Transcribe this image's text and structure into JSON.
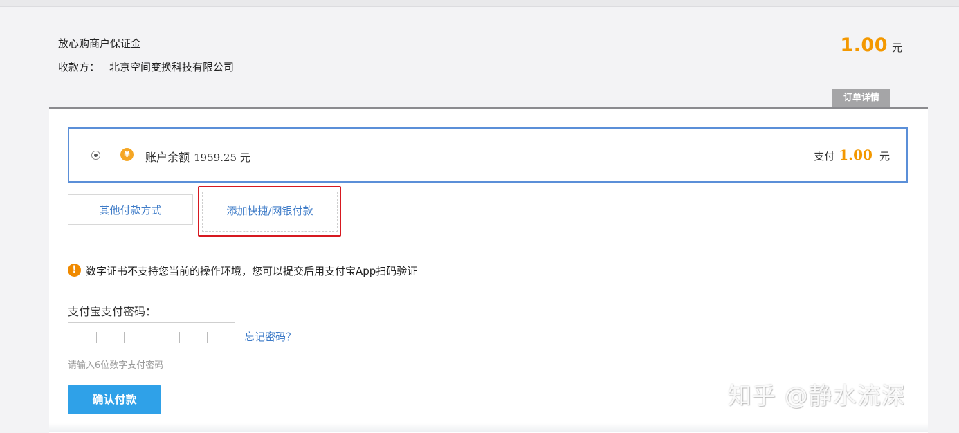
{
  "order": {
    "title": "放心购商户保证金",
    "payee_label": "收款方：",
    "payee_name": "北京空间变换科技有限公司",
    "amount": "1.00",
    "currency_unit": "元",
    "details_tab_label": "订单详情"
  },
  "payment_method": {
    "selected": true,
    "icon": "yen-icon",
    "label": "账户余额",
    "balance": "1959.25 元",
    "pay_label": "支付",
    "pay_amount": "1.00",
    "pay_unit": "元"
  },
  "alternatives": {
    "other_methods_label": "其他付款方式",
    "add_quick_pay_label": "添加快捷/网银付款",
    "highlight_color": "#d71920"
  },
  "warning": {
    "icon": "exclamation-icon",
    "text": "数字证书不支持您当前的操作环境，您可以提交后用支付宝App扫码验证"
  },
  "password": {
    "label": "支付宝支付密码：",
    "digits": 6,
    "forgot_label": "忘记密码？",
    "hint": "请输入6位数字支付密码"
  },
  "confirm_button_label": "确认付款",
  "watermark": "知乎 @静水流深",
  "colors": {
    "accent_orange": "#f39800",
    "link_blue": "#3f7cc8",
    "selected_border": "#5b8fd8",
    "confirm_button": "#2fa1e8"
  }
}
